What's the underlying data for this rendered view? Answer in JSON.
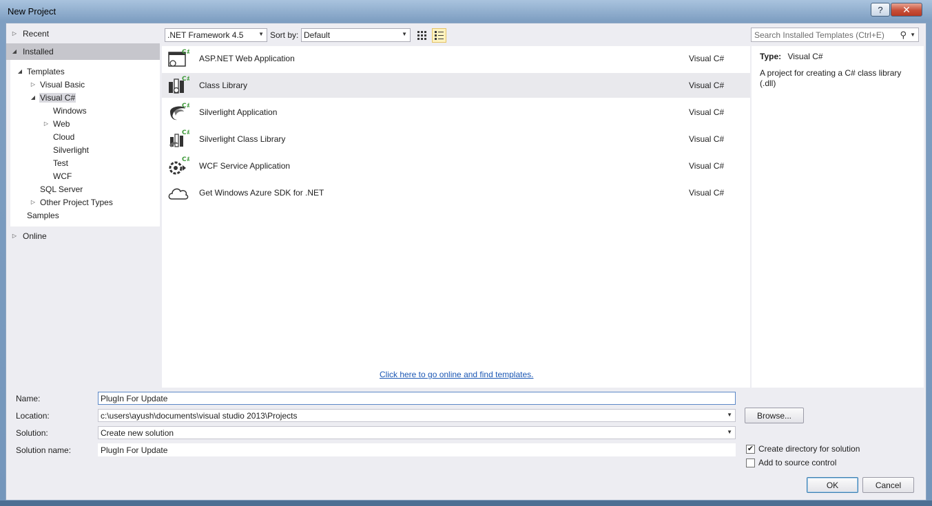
{
  "window": {
    "title": "New Project",
    "help_label": "?",
    "close_label": "✕"
  },
  "nav": {
    "recent": "Recent",
    "installed": "Installed",
    "templates": "Templates",
    "visual_basic": "Visual Basic",
    "visual_csharp": "Visual C#",
    "csharp_children": [
      "Windows",
      "Web",
      "Cloud",
      "Silverlight",
      "Test",
      "WCF"
    ],
    "sql_server": "SQL Server",
    "other_project_types": "Other Project Types",
    "samples": "Samples",
    "online": "Online"
  },
  "toolbar": {
    "framework": ".NET Framework 4.5",
    "sort_label": "Sort by:",
    "sort_value": "Default",
    "search_placeholder": "Search Installed Templates (Ctrl+E)"
  },
  "templates": [
    {
      "name": "ASP.NET Web Application",
      "lang": "Visual C#",
      "icon": "web-app-icon"
    },
    {
      "name": "Class Library",
      "lang": "Visual C#",
      "icon": "class-library-icon"
    },
    {
      "name": "Silverlight Application",
      "lang": "Visual C#",
      "icon": "silverlight-app-icon"
    },
    {
      "name": "Silverlight Class Library",
      "lang": "Visual C#",
      "icon": "silverlight-library-icon"
    },
    {
      "name": "WCF Service Application",
      "lang": "Visual C#",
      "icon": "wcf-service-icon"
    },
    {
      "name": "Get Windows Azure SDK for .NET",
      "lang": "Visual C#",
      "icon": "cloud-icon"
    }
  ],
  "online_link": "Click here to go online and find templates.",
  "details": {
    "type_label": "Type:",
    "type_value": "Visual C#",
    "description": "A project for creating a C# class library (.dll)"
  },
  "form": {
    "name_label": "Name:",
    "name_value": "PlugIn For Update",
    "location_label": "Location:",
    "location_value": "c:\\users\\ayush\\documents\\visual studio 2013\\Projects",
    "solution_label": "Solution:",
    "solution_value": "Create new solution",
    "solution_name_label": "Solution name:",
    "solution_name_value": "PlugIn For Update",
    "browse_label": "Browse...",
    "create_dir_label": "Create directory for solution",
    "create_dir_checked": true,
    "source_control_label": "Add to source control",
    "source_control_checked": false,
    "ok_label": "OK",
    "cancel_label": "Cancel"
  }
}
